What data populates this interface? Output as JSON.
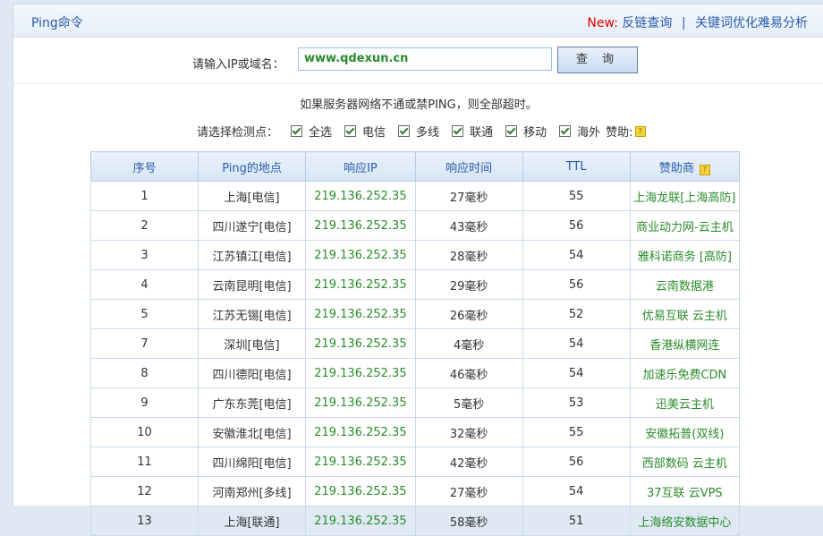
{
  "header": {
    "title": "Ping命令",
    "new_label": "New:",
    "link1": "反链查询",
    "separator": "|",
    "link2": "关键词优化难易分析"
  },
  "search": {
    "label": "请输入IP或域名：",
    "value": "www.qdexun.cn",
    "button": "查 询"
  },
  "notice": "如果服务器网络不通或禁PING，则全部超时。",
  "options": {
    "label": "请选择检测点：",
    "items": [
      "全选",
      "电信",
      "多线",
      "联通",
      "移动",
      "海外"
    ],
    "sponsor_label": "赞助:"
  },
  "table": {
    "headers": [
      "序号",
      "Ping的地点",
      "响应IP",
      "响应时间",
      "TTL",
      "赞助商"
    ],
    "rows": [
      {
        "no": "1",
        "loc": "上海[电信]",
        "ip": "219.136.252.35",
        "time": "27毫秒",
        "ttl": "55",
        "sponsor": "上海龙联[上海高防]"
      },
      {
        "no": "2",
        "loc": "四川遂宁[电信]",
        "ip": "219.136.252.35",
        "time": "43毫秒",
        "ttl": "56",
        "sponsor": "商业动力网-云主机"
      },
      {
        "no": "3",
        "loc": "江苏镇江[电信]",
        "ip": "219.136.252.35",
        "time": "28毫秒",
        "ttl": "54",
        "sponsor": "雅科诺商务 [高防]"
      },
      {
        "no": "4",
        "loc": "云南昆明[电信]",
        "ip": "219.136.252.35",
        "time": "29毫秒",
        "ttl": "56",
        "sponsor": "云南数据港"
      },
      {
        "no": "5",
        "loc": "江苏无锡[电信]",
        "ip": "219.136.252.35",
        "time": "26毫秒",
        "ttl": "52",
        "sponsor": "优易互联 云主机"
      },
      {
        "no": "7",
        "loc": "深圳[电信]",
        "ip": "219.136.252.35",
        "time": "4毫秒",
        "ttl": "54",
        "sponsor": "香港纵横网连"
      },
      {
        "no": "8",
        "loc": "四川德阳[电信]",
        "ip": "219.136.252.35",
        "time": "46毫秒",
        "ttl": "54",
        "sponsor": "加速乐免费CDN"
      },
      {
        "no": "9",
        "loc": "广东东莞[电信]",
        "ip": "219.136.252.35",
        "time": "5毫秒",
        "ttl": "53",
        "sponsor": "迅美云主机"
      },
      {
        "no": "10",
        "loc": "安徽淮北[电信]",
        "ip": "219.136.252.35",
        "time": "32毫秒",
        "ttl": "55",
        "sponsor": "安徽拓普(双线)"
      },
      {
        "no": "11",
        "loc": "四川绵阳[电信]",
        "ip": "219.136.252.35",
        "time": "42毫秒",
        "ttl": "56",
        "sponsor": "西部数码 云主机"
      },
      {
        "no": "12",
        "loc": "河南郑州[多线]",
        "ip": "219.136.252.35",
        "time": "27毫秒",
        "ttl": "54",
        "sponsor": "37互联 云VPS"
      },
      {
        "no": "13",
        "loc": "上海[联通]",
        "ip": "219.136.252.35",
        "time": "58毫秒",
        "ttl": "51",
        "sponsor": "上海络安数据中心"
      }
    ]
  }
}
